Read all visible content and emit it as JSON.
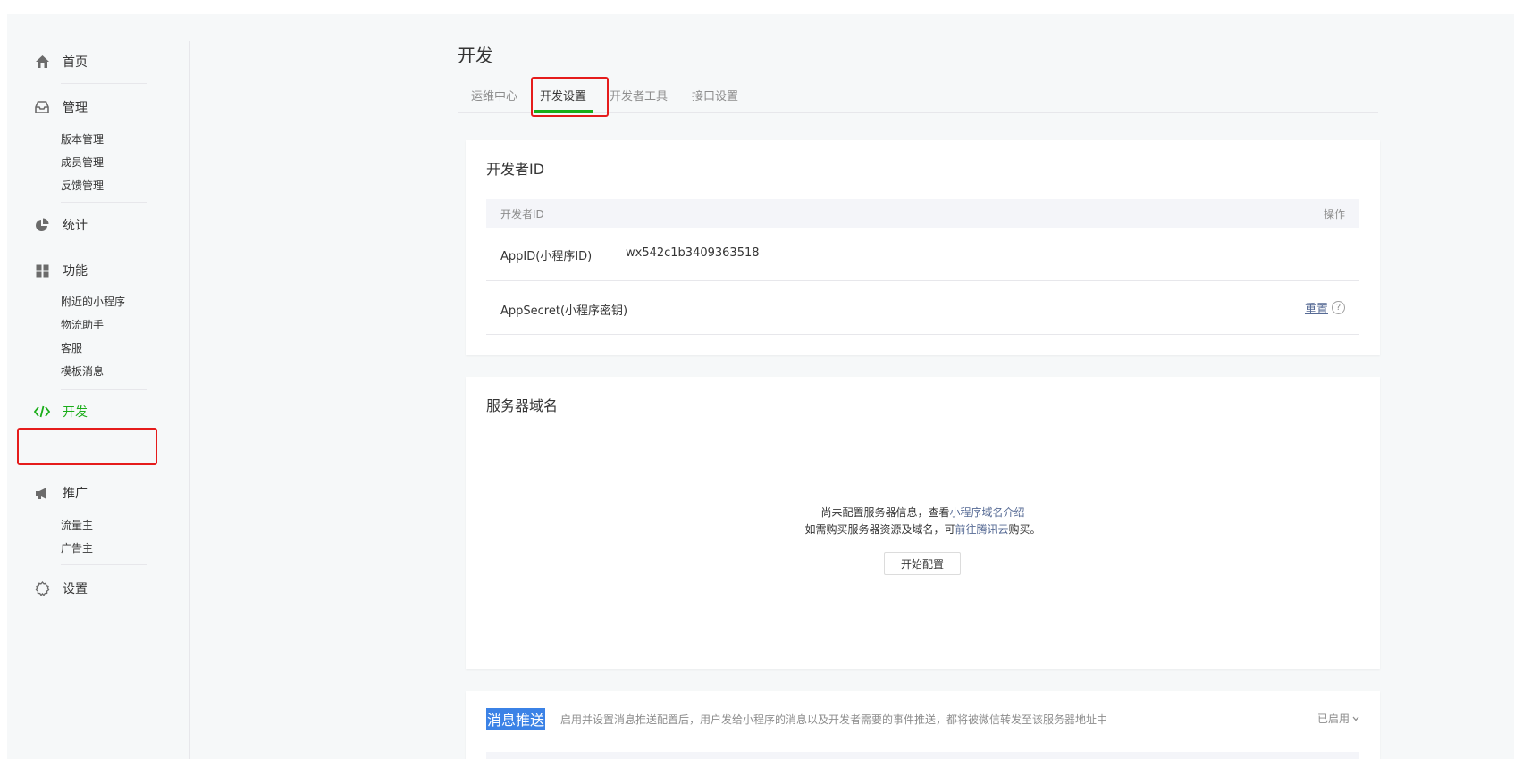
{
  "sidebar": {
    "home": "首页",
    "manage": "管理",
    "manage_items": [
      "版本管理",
      "成员管理",
      "反馈管理"
    ],
    "stats": "统计",
    "features": "功能",
    "feature_items": [
      "附近的小程序",
      "物流助手",
      "客服",
      "模板消息"
    ],
    "develop": "开发",
    "promote": "推广",
    "promote_items": [
      "流量主",
      "广告主"
    ],
    "settings": "设置"
  },
  "main": {
    "title": "开发",
    "tabs": [
      "运维中心",
      "开发设置",
      "开发者工具",
      "接口设置"
    ],
    "active_tab": 1,
    "developer_id": {
      "title": "开发者ID",
      "col_id": "开发者ID",
      "col_action": "操作",
      "appid_label": "AppID(小程序ID)",
      "appid_value": "wx542c1b3409363518",
      "secret_label": "AppSecret(小程序密钥)",
      "reset": "重置",
      "help": "?"
    },
    "server_domain": {
      "title": "服务器域名",
      "line1_prefix": "尚未配置服务器信息，查看",
      "line1_link": "小程序域名介绍",
      "line2_prefix": "如需购买服务器资源及域名，可",
      "line2_link": "前往腾讯云",
      "line2_suffix": "购买。",
      "button": "开始配置"
    },
    "message_push": {
      "title": "消息推送",
      "desc": "启用并设置消息推送配置后，用户发给小程序的消息以及开发者需要的事件推送，都将被微信转发至该服务器地址中",
      "status": "已启用"
    }
  },
  "colors": {
    "accent": "#1aad19",
    "highlight": "#e51c1c",
    "link": "#576b95"
  }
}
